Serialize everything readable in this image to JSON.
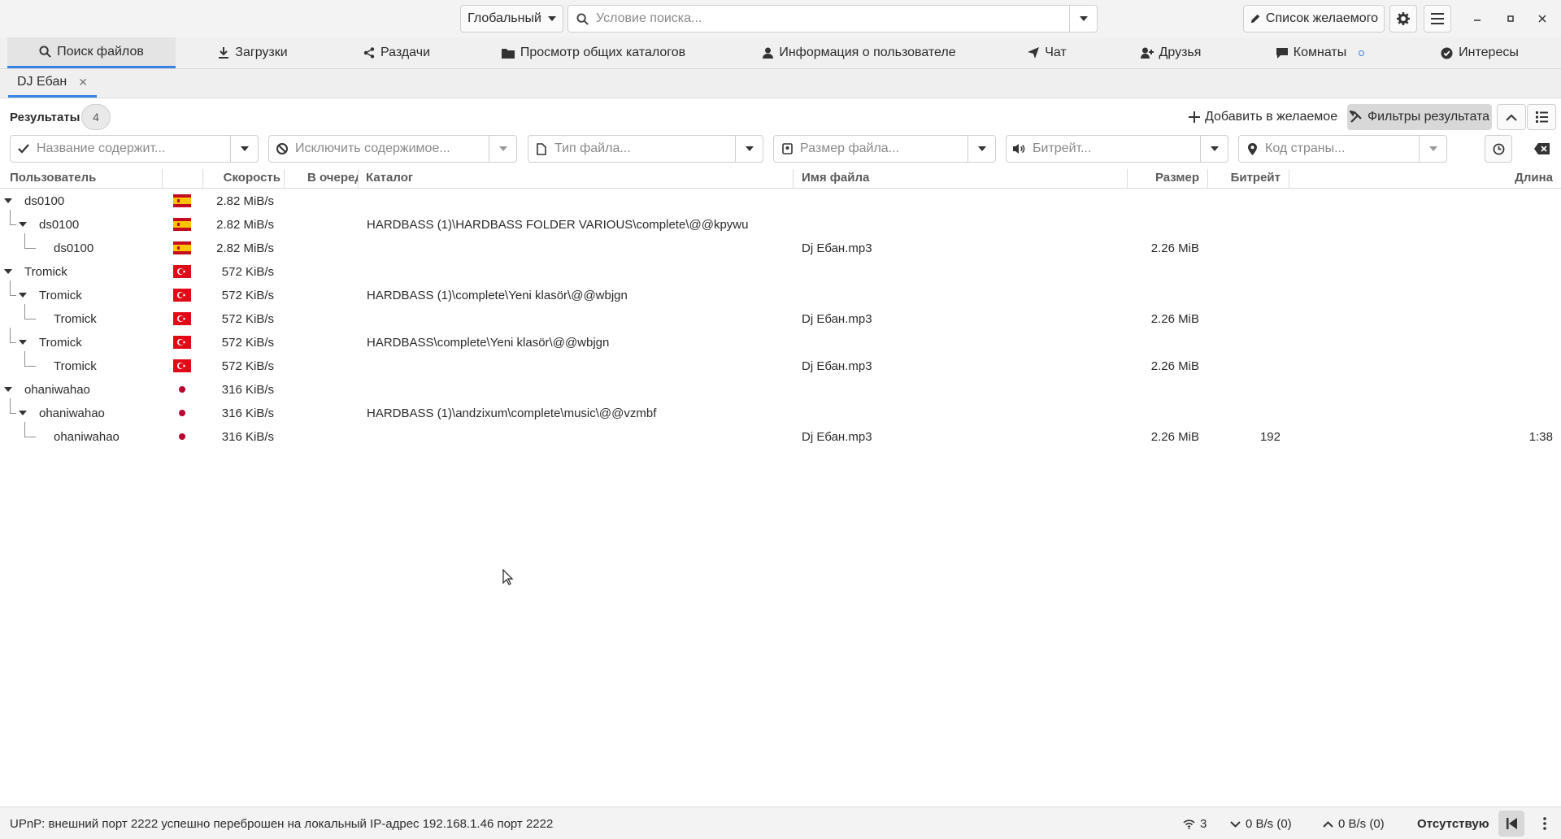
{
  "header": {
    "scope": "Глобальный",
    "search_placeholder": "Условие поиска...",
    "wishlist_label": "Список желаемого"
  },
  "nav": {
    "items": [
      {
        "label": "Поиск файлов",
        "icon": "search-icon",
        "active": true
      },
      {
        "label": "Загрузки",
        "icon": "download-icon"
      },
      {
        "label": "Раздачи",
        "icon": "share-icon"
      },
      {
        "label": "Просмотр общих каталогов",
        "icon": "folder-icon"
      },
      {
        "label": "Информация о пользователе",
        "icon": "user-icon"
      },
      {
        "label": "Чат",
        "icon": "paper-plane-icon"
      },
      {
        "label": "Друзья",
        "icon": "user-plus-icon"
      },
      {
        "label": "Комнаты",
        "icon": "comment-icon"
      },
      {
        "label": "Интересы",
        "icon": "check-circle-icon"
      }
    ]
  },
  "subtab": {
    "label": "DJ Ебан"
  },
  "results": {
    "title": "Результаты",
    "count": "4",
    "add_wish_label": "Добавить в желаемое",
    "filters_label": "Фильтры результата"
  },
  "filters": {
    "include": "Название содержит...",
    "exclude": "Исключить содержимое...",
    "filetype": "Тип файла...",
    "filesize": "Размер файла...",
    "bitrate": "Битрейт...",
    "country": "Код страны..."
  },
  "columns": {
    "user": "Пользователь",
    "speed": "Скорость",
    "queue": "В очереди",
    "folder": "Каталог",
    "filename": "Имя файла",
    "size": "Размер",
    "bitrate": "Битрейт",
    "length": "Длина"
  },
  "rows": [
    {
      "user": "ds0100",
      "level": 0,
      "expander": true,
      "flag": "ES",
      "speed": "2.82 MiB/s",
      "folder": "",
      "filename": "",
      "size": "",
      "bitrate": "",
      "length": ""
    },
    {
      "user": "ds0100",
      "level": 1,
      "expander": true,
      "flag": "ES",
      "speed": "2.82 MiB/s",
      "folder": "HARDBASS (1)\\HARDBASS FOLDER VARIOUS\\complete\\@@kpywu",
      "filename": "",
      "size": "",
      "bitrate": "",
      "length": ""
    },
    {
      "user": "ds0100",
      "level": 2,
      "expander": false,
      "flag": "ES",
      "speed": "2.82 MiB/s",
      "folder": "",
      "filename": "Dj Ебан.mp3",
      "size": "2.26 MiB",
      "bitrate": "",
      "length": ""
    },
    {
      "user": "Tromick",
      "level": 0,
      "expander": true,
      "flag": "TR",
      "speed": "572 KiB/s",
      "folder": "",
      "filename": "",
      "size": "",
      "bitrate": "",
      "length": ""
    },
    {
      "user": "Tromick",
      "level": 1,
      "expander": true,
      "flag": "TR",
      "speed": "572 KiB/s",
      "folder": "HARDBASS (1)\\complete\\Yeni klasör\\@@wbjgn",
      "filename": "",
      "size": "",
      "bitrate": "",
      "length": ""
    },
    {
      "user": "Tromick",
      "level": 2,
      "expander": false,
      "flag": "TR",
      "speed": "572 KiB/s",
      "folder": "",
      "filename": "Dj Ебан.mp3",
      "size": "2.26 MiB",
      "bitrate": "",
      "length": ""
    },
    {
      "user": "Tromick",
      "level": 1,
      "expander": true,
      "flag": "TR",
      "speed": "572 KiB/s",
      "folder": "HARDBASS\\complete\\Yeni klasör\\@@wbjgn",
      "filename": "",
      "size": "",
      "bitrate": "",
      "length": ""
    },
    {
      "user": "Tromick",
      "level": 2,
      "expander": false,
      "flag": "TR",
      "speed": "572 KiB/s",
      "folder": "",
      "filename": "Dj Ебан.mp3",
      "size": "2.26 MiB",
      "bitrate": "",
      "length": ""
    },
    {
      "user": "ohaniwahao",
      "level": 0,
      "expander": true,
      "flag": "JP",
      "speed": "316 KiB/s",
      "folder": "",
      "filename": "",
      "size": "",
      "bitrate": "",
      "length": ""
    },
    {
      "user": "ohaniwahao",
      "level": 1,
      "expander": true,
      "flag": "JP",
      "speed": "316 KiB/s",
      "folder": "HARDBASS (1)\\andzixum\\complete\\music\\@@vzmbf",
      "filename": "",
      "size": "",
      "bitrate": "",
      "length": ""
    },
    {
      "user": "ohaniwahao",
      "level": 2,
      "expander": false,
      "flag": "JP",
      "speed": "316 KiB/s",
      "folder": "",
      "filename": "Dj Ебан.mp3",
      "size": "2.26 MiB",
      "bitrate": "192",
      "length": "1:38"
    }
  ],
  "status": {
    "message": "UPnP: внешний порт 2222 успешно переброшен на локальный IP-адрес 192.168.1.46 порт 2222",
    "connections": "3",
    "download": "0 B/s (0)",
    "upload": "0 B/s (0)",
    "away": "Отсутствую"
  },
  "colors": {
    "accent": "#3584e4",
    "flag_es_red": "#c60b1e",
    "flag_es_yellow": "#ffc400",
    "flag_tr_red": "#e30a17",
    "flag_jp_red": "#bc002d"
  }
}
